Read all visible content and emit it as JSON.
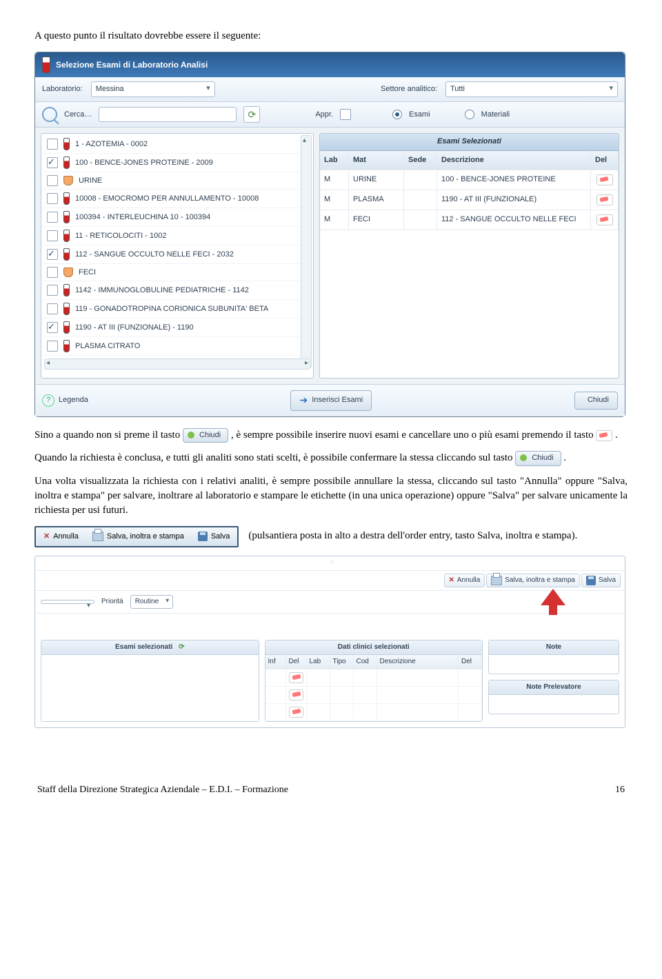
{
  "doc": {
    "intro": "A questo punto il risultato dovrebbe essere il seguente:",
    "p1a": "Sino a quando non si preme il tasto ",
    "p1b": ", è sempre possibile inserire nuovi esami e cancellare uno o più esami premendo il tasto ",
    "p1c": ".",
    "p2a": "Quando la richiesta è conclusa, e tutti gli analiti sono stati scelti, è possibile confermare la stessa cliccando sul tasto ",
    "p2b": ".",
    "p3": "Una volta visualizzata la richiesta con i relativi analiti, è sempre possibile annullare la stessa, cliccando sul tasto \"Annulla\" oppure \"Salva, inoltra e stampa\" per salvare, inoltrare al laboratorio e stampare le etichette (in una unica operazione) oppure \"Salva\" per salvare unicamente la richiesta per usi futuri.",
    "p4a": "(pulsantiera posta in alto a destra dell'order entry, tasto Salva, inoltra e stampa).",
    "footer_left": "Staff della Direzione Strategica Aziendale – E.D.I. – Formazione",
    "footer_right": "16",
    "chiudi_label": "Chiudi"
  },
  "dialog": {
    "title": "Selezione Esami di Laboratorio Analisi",
    "lab_label": "Laboratorio:",
    "lab_value": "Messina",
    "sector_label": "Settore analitico:",
    "sector_value": "Tutti",
    "cerca_label": "Cerca…",
    "appr_label": "Appr.",
    "radio_esami": "Esami",
    "radio_materiali": "Materiali",
    "list": [
      {
        "checked": false,
        "icon": "tube",
        "label": "1 - AZOTEMIA - 0002"
      },
      {
        "checked": true,
        "icon": "tube",
        "label": "100 - BENCE-JONES PROTEINE - 2009"
      },
      {
        "checked": false,
        "icon": "cup",
        "label": "URINE"
      },
      {
        "checked": false,
        "icon": "tube",
        "label": "10008 - EMOCROMO PER ANNULLAMENTO - 10008"
      },
      {
        "checked": false,
        "icon": "tube",
        "label": "100394 - INTERLEUCHINA 10 - 100394"
      },
      {
        "checked": false,
        "icon": "tube",
        "label": "11 - RETICOLOCITI - 1002"
      },
      {
        "checked": true,
        "icon": "tube",
        "label": "112 - SANGUE OCCULTO NELLE FECI  - 2032"
      },
      {
        "checked": false,
        "icon": "cup",
        "label": "FECI"
      },
      {
        "checked": false,
        "icon": "tube",
        "label": "1142 - IMMUNOGLOBULINE PEDIATRICHE - 1142"
      },
      {
        "checked": false,
        "icon": "tube",
        "label": "119 - GONADOTROPINA CORIONICA SUBUNITA' BETA"
      },
      {
        "checked": true,
        "icon": "tube",
        "label": "1190 - AT III (FUNZIONALE) - 1190"
      },
      {
        "checked": false,
        "icon": "tube",
        "label": "PLASMA CITRATO"
      }
    ],
    "selected_title": "Esami Selezionati",
    "cols": {
      "lab": "Lab",
      "mat": "Mat",
      "sede": "Sede",
      "desc": "Descrizione",
      "del": "Del"
    },
    "selected": [
      {
        "lab": "M",
        "mat": "URINE",
        "sede": "",
        "desc": "100 - BENCE-JONES PROTEINE"
      },
      {
        "lab": "M",
        "mat": "PLASMA",
        "sede": "",
        "desc": "1190 - AT III (FUNZIONALE)"
      },
      {
        "lab": "M",
        "mat": "FECI",
        "sede": "",
        "desc": "112 - SANGUE OCCULTO NELLE FECI"
      }
    ],
    "legenda": "Legenda",
    "inserisci": "Inserisci Esami",
    "chiudi": "Chiudi"
  },
  "toolbar": {
    "annulla": "Annulla",
    "salva_inoltra": "Salva, inoltra e stampa",
    "salva": "Salva"
  },
  "grid": {
    "priorita_label": "Priorità",
    "priorita_value": "Routine",
    "tb": {
      "annulla": "Annulla",
      "sis": "Salva, inoltra e stampa",
      "salva": "Salva"
    },
    "panel_esami": "Esami selezionati",
    "panel_dati": "Dati clinici selezionati",
    "panel_note": "Note",
    "panel_note_prel": "Note Prelevatore",
    "dati_cols": {
      "inf": "Inf",
      "del": "Del",
      "lab": "Lab",
      "tipo": "Tipo",
      "cod": "Cod",
      "desc": "Descrizione",
      "del2": "Del"
    }
  }
}
